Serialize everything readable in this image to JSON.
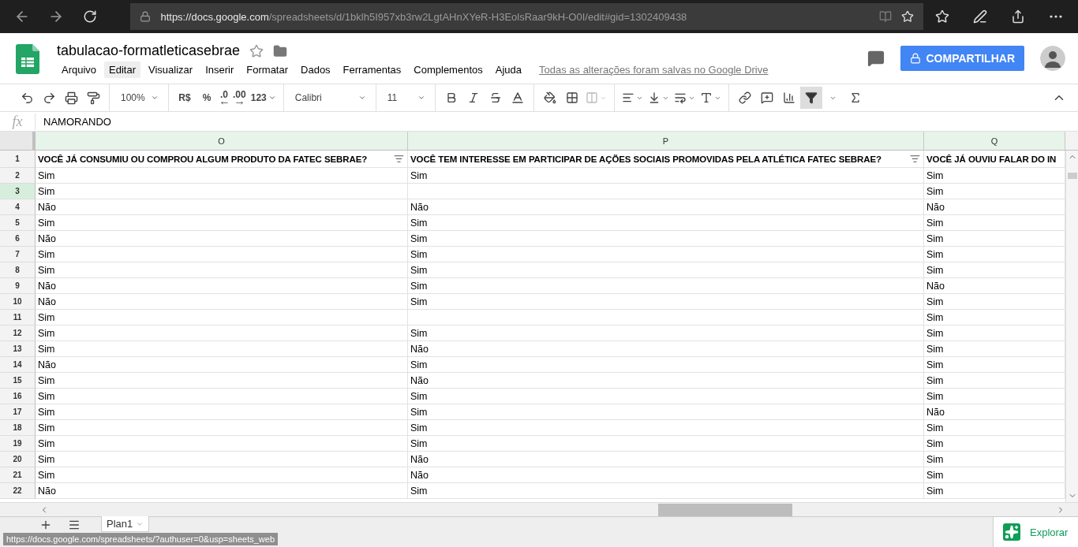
{
  "browser": {
    "url_host": "https://docs.google.com",
    "url_path": "/spreadsheets/d/1bklh5I957xb3rw2LgtAHnXYeR-H3EolsRaar9kH-O0I/edit#gid=1302409438"
  },
  "doc": {
    "title": "tabulacao-formatleticasebrae",
    "starred": false
  },
  "menu": [
    {
      "label": "Arquivo",
      "highlighted": false
    },
    {
      "label": "Editar",
      "highlighted": true
    },
    {
      "label": "Visualizar",
      "highlighted": false
    },
    {
      "label": "Inserir",
      "highlighted": false
    },
    {
      "label": "Formatar",
      "highlighted": false
    },
    {
      "label": "Dados",
      "highlighted": false
    },
    {
      "label": "Ferramentas",
      "highlighted": false
    },
    {
      "label": "Complementos",
      "highlighted": false
    },
    {
      "label": "Ajuda",
      "highlighted": false
    }
  ],
  "save_status": "Todas as alterações foram salvas no Google Drive",
  "share_button": "COMPARTILHAR",
  "toolbar": {
    "zoom": "100%",
    "currency": "R$",
    "percent": "%",
    "decrease_decimals": ".0",
    "increase_decimals": ".00",
    "number_format": "123",
    "font": "Calibri",
    "font_size": "11",
    "filter_on": true
  },
  "formula_bar": {
    "fx": "fx",
    "value": "NAMORANDO"
  },
  "columns": [
    {
      "letter": "O",
      "header": "VOCÊ JÁ CONSUMIU OU COMPROU ALGUM PRODUTO DA FATEC SEBRAE?",
      "filter": true
    },
    {
      "letter": "P",
      "header": "VOCÊ TEM INTERESSE EM PARTICIPAR DE AÇÕES SOCIAIS PROMOVIDAS PELA ATLÉTICA FATEC SEBRAE?",
      "filter": true
    },
    {
      "letter": "Q",
      "header": "VOCÊ JÁ OUVIU FALAR DO IN",
      "filter": false
    }
  ],
  "header_row": "1",
  "rows": [
    {
      "number": "2",
      "selected": false,
      "cells": [
        "Sim",
        "Sim",
        "Sim"
      ]
    },
    {
      "number": "3",
      "selected": true,
      "cells": [
        "Sim",
        null,
        "Sim"
      ]
    },
    {
      "number": "4",
      "selected": false,
      "cells": [
        "Não",
        "Não",
        "Não"
      ]
    },
    {
      "number": "5",
      "selected": false,
      "cells": [
        "Sim",
        "Sim",
        "Sim"
      ]
    },
    {
      "number": "6",
      "selected": false,
      "cells": [
        "Não",
        "Sim",
        "Sim"
      ]
    },
    {
      "number": "7",
      "selected": false,
      "cells": [
        "Sim",
        "Sim",
        "Sim"
      ]
    },
    {
      "number": "8",
      "selected": false,
      "cells": [
        "Sim",
        "Sim",
        "Sim"
      ]
    },
    {
      "number": "9",
      "selected": false,
      "cells": [
        "Não",
        "Sim",
        "Não"
      ]
    },
    {
      "number": "10",
      "selected": false,
      "cells": [
        "Não",
        "Sim",
        "Sim"
      ]
    },
    {
      "number": "11",
      "selected": false,
      "cells": [
        "Sim",
        null,
        "Sim"
      ]
    },
    {
      "number": "12",
      "selected": false,
      "cells": [
        "Sim",
        "Sim",
        "Sim"
      ]
    },
    {
      "number": "13",
      "selected": false,
      "cells": [
        "Sim",
        "Não",
        "Sim"
      ]
    },
    {
      "number": "14",
      "selected": false,
      "cells": [
        "Não",
        "Sim",
        "Sim"
      ]
    },
    {
      "number": "15",
      "selected": false,
      "cells": [
        "Sim",
        "Não",
        "Sim"
      ]
    },
    {
      "number": "16",
      "selected": false,
      "cells": [
        "Sim",
        "Sim",
        "Sim"
      ]
    },
    {
      "number": "17",
      "selected": false,
      "cells": [
        "Sim",
        "Sim",
        "Não"
      ]
    },
    {
      "number": "18",
      "selected": false,
      "cells": [
        "Sim",
        "Sim",
        "Sim"
      ]
    },
    {
      "number": "19",
      "selected": false,
      "cells": [
        "Sim",
        "Sim",
        "Sim"
      ]
    },
    {
      "number": "20",
      "selected": false,
      "cells": [
        "Sim",
        "Não",
        "Sim"
      ]
    },
    {
      "number": "21",
      "selected": false,
      "cells": [
        "Sim",
        "Não",
        "Sim"
      ]
    },
    {
      "number": "22",
      "selected": false,
      "cells": [
        "Não",
        "Sim",
        "Sim"
      ]
    }
  ],
  "sheets": [
    {
      "name": "Plan1",
      "selected": true
    }
  ],
  "explore_button": "Explorar",
  "status_url": "https://docs.google.com/spreadsheets/?authuser=0&usp=sheets_web"
}
